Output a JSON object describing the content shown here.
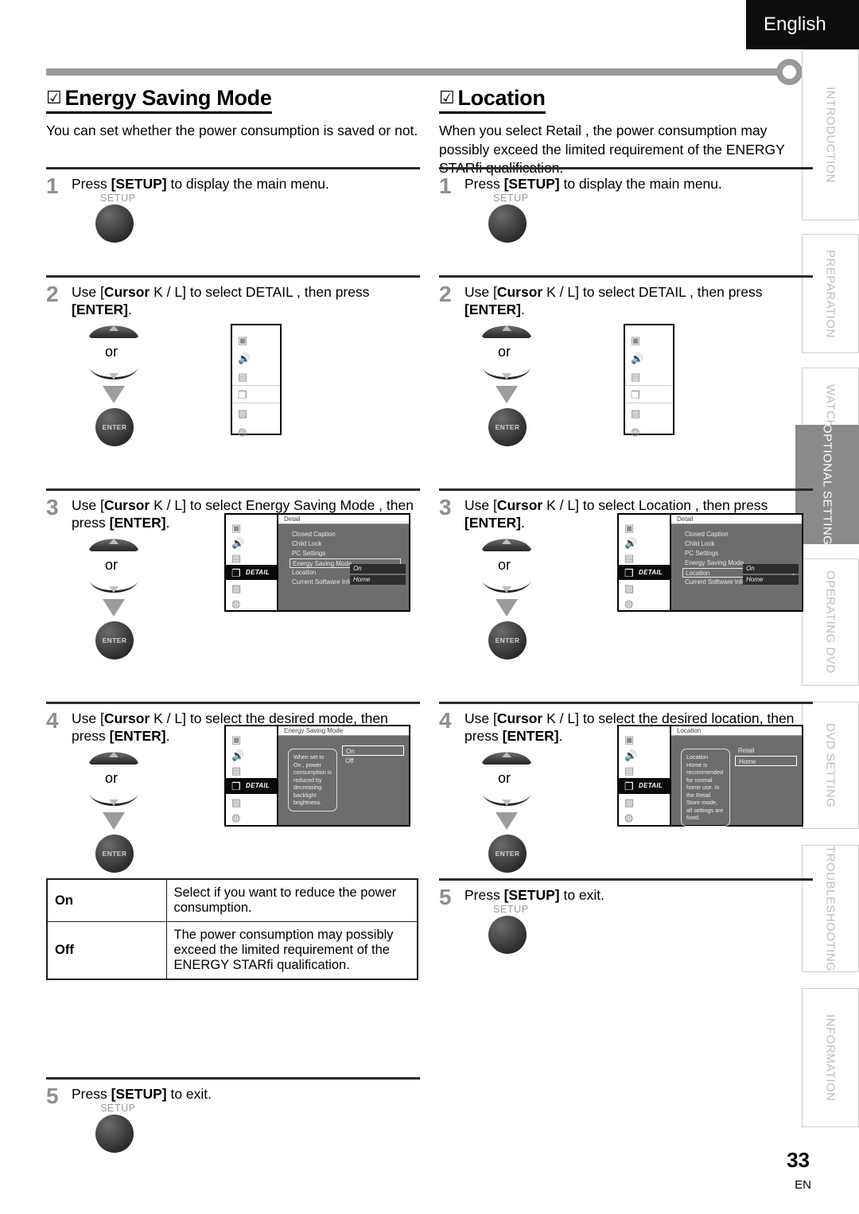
{
  "header": {
    "language": "English"
  },
  "footer": {
    "page_number": "33",
    "lang_code": "EN"
  },
  "side_tabs": [
    {
      "label": "INTRODUCTION",
      "active": false
    },
    {
      "label": "PREPARATION",
      "active": false
    },
    {
      "label": "WATCHING TV",
      "active": false
    },
    {
      "label": "OPTIONAL SETTING",
      "active": true
    },
    {
      "label": "OPERATING DVD",
      "active": false
    },
    {
      "label": "DVD SETTING",
      "active": false
    },
    {
      "label": "TROUBLESHOOTING",
      "active": false
    },
    {
      "label": "INFORMATION",
      "active": false
    }
  ],
  "left": {
    "checkbox": "☑",
    "title": "Energy Saving Mode",
    "intro": "You can set whether the power consumption is saved or not.",
    "steps": [
      {
        "num": "1",
        "text_html": "Press [SETUP] to display the main menu."
      },
      {
        "num": "2",
        "text_html": "Use [Cursor K / L] to select  DETAIL , then press [ENTER]."
      },
      {
        "num": "3",
        "text_html": "Use [Cursor K / L] to select  Energy Saving Mode , then press [ENTER]."
      },
      {
        "num": "4",
        "text_html": "Use [Cursor K / L] to select the desired mode, then press [ENTER]."
      },
      {
        "num": "5",
        "text_html": "Press [SETUP] to exit."
      }
    ],
    "buttons": {
      "setup": "SETUP",
      "enter": "ENTER",
      "or": "or"
    },
    "osd_step3": {
      "title": "Detail",
      "side_label": "DETAIL",
      "items": [
        "Closed Caption",
        "Child Lock",
        "PC Settings",
        "Energy Saving Mode",
        "Location",
        "Current Software Info"
      ],
      "highlighted_item": "Energy Saving Mode",
      "values": [
        {
          "label": "On",
          "highlighted": false
        },
        {
          "label": "Home",
          "highlighted": false
        }
      ]
    },
    "osd_step4": {
      "title": "Energy Saving Mode",
      "side_label": "DETAIL",
      "bubble": "When set to  On , power consumption is reduced by decreasing backlight brightness.",
      "options": [
        {
          "label": "On",
          "highlighted": true
        },
        {
          "label": "Off",
          "highlighted": false
        }
      ]
    },
    "table": {
      "rows": [
        {
          "key": "On",
          "desc": "Select if you want to reduce the power consumption."
        },
        {
          "key": "Off",
          "desc": "The power consumption may possibly exceed the limited requirement of the ENERGY STARfi qualification."
        }
      ]
    }
  },
  "right": {
    "checkbox": "☑",
    "title": "Location",
    "intro": "When you select  Retail , the power consumption may possibly exceed the limited requirement of the ENERGY STARfi qualification.",
    "steps": [
      {
        "num": "1",
        "text_html": "Press [SETUP] to display the main menu."
      },
      {
        "num": "2",
        "text_html": "Use [Cursor K / L] to select  DETAIL , then press [ENTER]."
      },
      {
        "num": "3",
        "text_html": "Use [Cursor K / L] to select  Location , then press [ENTER]."
      },
      {
        "num": "4",
        "text_html": "Use [Cursor K / L] to select the desired location, then press [ENTER]."
      },
      {
        "num": "5",
        "text_html": "Press [SETUP] to exit."
      }
    ],
    "buttons": {
      "setup": "SETUP",
      "enter": "ENTER",
      "or": "or"
    },
    "osd_step3": {
      "title": "Detail",
      "side_label": "DETAIL",
      "items": [
        "Closed Caption",
        "Child Lock",
        "PC Settings",
        "Energy Saving Mode",
        "Location",
        "Current Software Info"
      ],
      "highlighted_item": "Location",
      "values": [
        {
          "label": "On",
          "highlighted": false
        },
        {
          "label": "Home",
          "highlighted": false
        }
      ]
    },
    "osd_step4": {
      "title": "Location",
      "side_label": "DETAIL",
      "bubble": "Location Home is recommended for normal home use. In the Retail Store mode, all settings are fixed.",
      "options": [
        {
          "label": "Retail",
          "highlighted": false
        },
        {
          "label": "Home",
          "highlighted": true
        }
      ]
    }
  }
}
